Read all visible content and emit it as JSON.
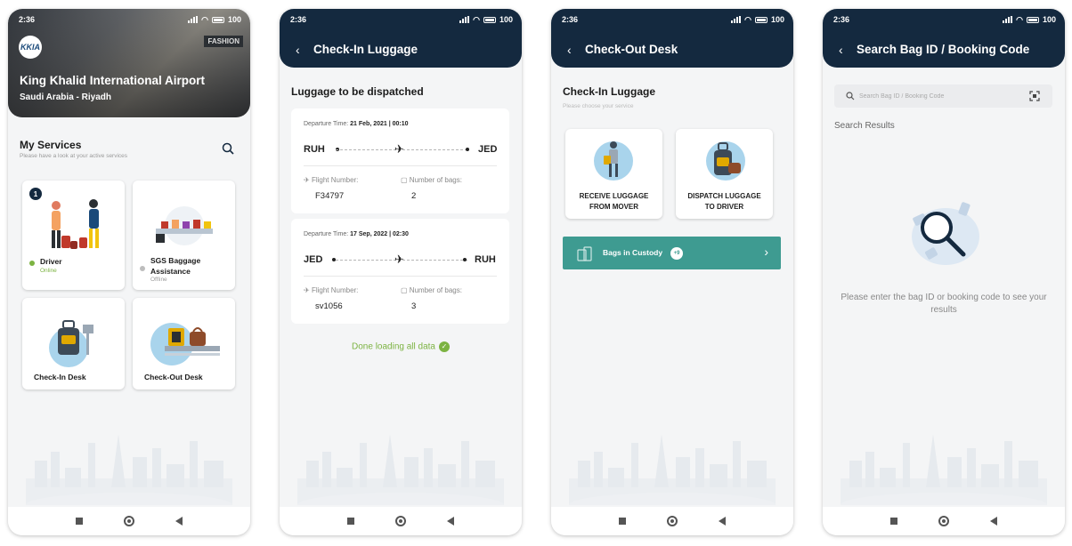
{
  "status": {
    "time": "2:36",
    "battery": "100"
  },
  "screen1": {
    "airport_name": "King Khalid International Airport",
    "location": "Saudi Arabia - Riyadh",
    "logo_text": "KKIA",
    "sign_text": "FASHION",
    "section_title": "My Services",
    "section_subtitle": "Please have a look at your active services",
    "services": [
      {
        "label": "Driver",
        "status": "Online",
        "badge": "1",
        "status_color": "#7cb342"
      },
      {
        "label": "SGS Baggage Assistance",
        "status": "Offline",
        "status_color": "#bdbdbd"
      },
      {
        "label": "Check-In Desk"
      },
      {
        "label": "Check-Out Desk"
      }
    ]
  },
  "screen2": {
    "title": "Check-In Luggage",
    "heading": "Luggage to be dispatched",
    "flights": [
      {
        "departure_label": "Departure Time:",
        "departure_time": "21 Feb, 2021 | 00:10",
        "from": "RUH",
        "to": "JED",
        "flight_label": "Flight Number:",
        "flight_number": "F34797",
        "bags_label": "Number of bags:",
        "bags": "2"
      },
      {
        "departure_label": "Departure Time:",
        "departure_time": "17 Sep, 2022 | 02:30",
        "from": "JED",
        "to": "RUH",
        "flight_label": "Flight Number:",
        "flight_number": "sv1056",
        "bags_label": "Number of bags:",
        "bags": "3"
      }
    ],
    "done_text": "Done loading all data"
  },
  "screen3": {
    "title": "Check-Out Desk",
    "heading": "Check-In Luggage",
    "subheading": "Please choose your service",
    "options": [
      {
        "line1": "RECEIVE LUGGAGE",
        "line2": "FROM MOVER"
      },
      {
        "line1": "DISPATCH LUGGAGE",
        "line2": "TO DRIVER"
      }
    ],
    "custody_label": "Bags in Custody",
    "custody_count": "+9"
  },
  "screen4": {
    "title": "Search Bag ID / Booking Code",
    "search_placeholder": "Search Bag ID / Booking Code",
    "results_title": "Search Results",
    "empty_message": "Please enter the bag ID or booking code to see your results"
  },
  "colors": {
    "appbar": "#14293f",
    "accent_green": "#7cb342",
    "custody_teal": "#3e9b91",
    "background": "#f4f5f6"
  }
}
